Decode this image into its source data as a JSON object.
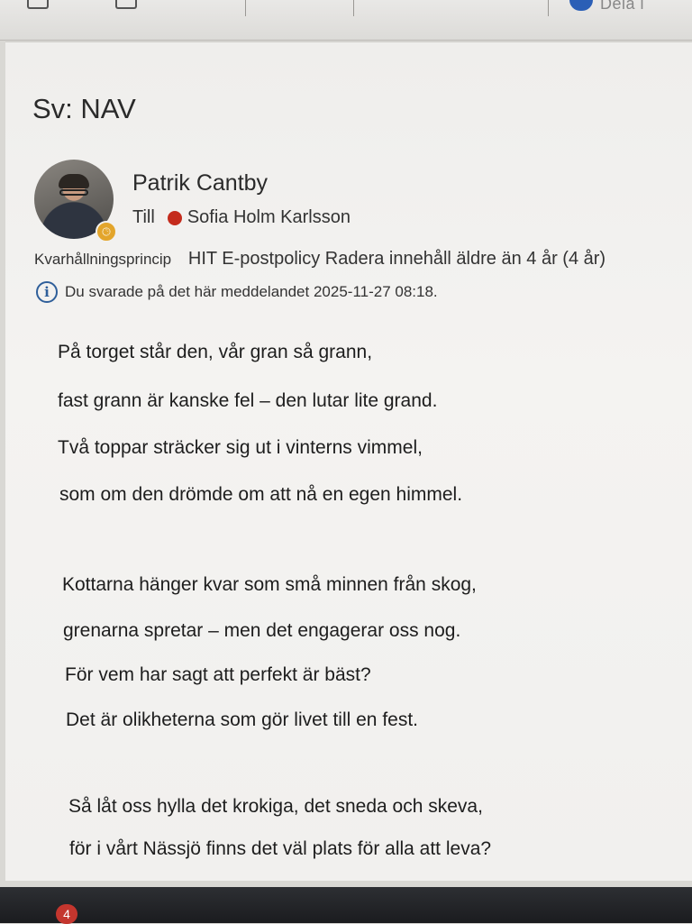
{
  "toolbar": {
    "share_label": "Dela i"
  },
  "message": {
    "subject": "Sv: NAV",
    "sender": "Patrik Cantby",
    "to_label": "Till",
    "recipient": "Sofia Holm Karlsson",
    "retention_label": "Kvarhållningsprincip",
    "retention_policy": "HIT E-postpolicy Radera innehåll äldre än 4 år (4 år)",
    "info_text": "Du svarade på det här meddelandet 2025-11-27 08:18.",
    "body_lines": [
      "På torget står den, vår gran så grann,",
      "fast grann är kanske fel – den lutar lite grand.",
      "Två toppar sträcker sig ut i vinterns vimmel,",
      "som om den drömde om att nå en egen himmel.",
      "Kottarna hänger kvar som små minnen från skog,",
      "grenarna spretar – men det engagerar oss nog.",
      "För vem har sagt att perfekt är bäst?",
      "Det är olikheterna som gör livet till en fest.",
      "Så låt oss hylla det krokiga, det sneda och skeva,",
      "för i vårt Nässjö finns det väl plats för alla att leva?"
    ]
  },
  "taskbar": {
    "badge_count": "4"
  },
  "colors": {
    "presence_busy": "#c42b1c",
    "status_away": "#e3a52b",
    "info_blue": "#2f5f9a",
    "badge_red": "#c4362e"
  },
  "icons": {
    "info": "info-icon",
    "presence": "presence-busy-icon",
    "status": "clock-status-icon"
  }
}
